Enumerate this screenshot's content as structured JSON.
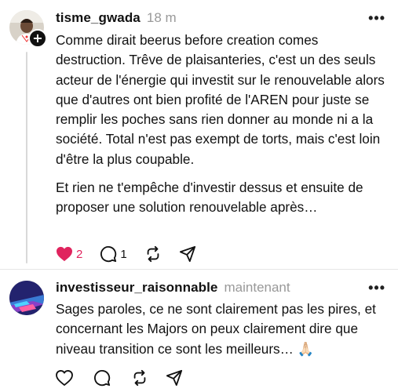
{
  "posts": [
    {
      "username": "tisme_gwada",
      "time": "18 m",
      "more_label": "•••",
      "follow_badge": "+",
      "paragraphs": [
        "Comme dirait beerus before creation comes destruction. Trêve de plaisanteries, c'est un des seuls acteur de l'énergie qui investit sur le renouvelable alors que d'autres ont bien profité de l'AREN pour juste se remplir les poches sans rien donner au monde ni a la société. Total n'est pas exempt de torts, mais c'est loin d'être la plus coupable.",
        "Et rien ne t'empêche d'investir dessus et ensuite de proposer une solution renouvelable après…"
      ],
      "actions": {
        "likes": "2",
        "liked": true,
        "replies": "1",
        "reposts": "",
        "shares": ""
      }
    },
    {
      "username": "investisseur_raisonnable",
      "time": "maintenant",
      "more_label": "•••",
      "paragraphs": [
        "Sages paroles, ce ne sont clairement pas les pires, et concernant les Majors on peux clairement dire que niveau transition ce sont les meilleurs… 🙏🏻"
      ],
      "actions": {
        "likes": "",
        "liked": false,
        "replies": "",
        "reposts": "",
        "shares": ""
      }
    }
  ],
  "colors": {
    "like_active": "#e0245e",
    "text": "#111111",
    "muted": "#999999",
    "thread_line": "#d9d9d9"
  },
  "icons": {
    "like": "heart-icon",
    "reply": "comment-icon",
    "repost": "repost-icon",
    "share": "send-icon",
    "more": "more-icon"
  }
}
